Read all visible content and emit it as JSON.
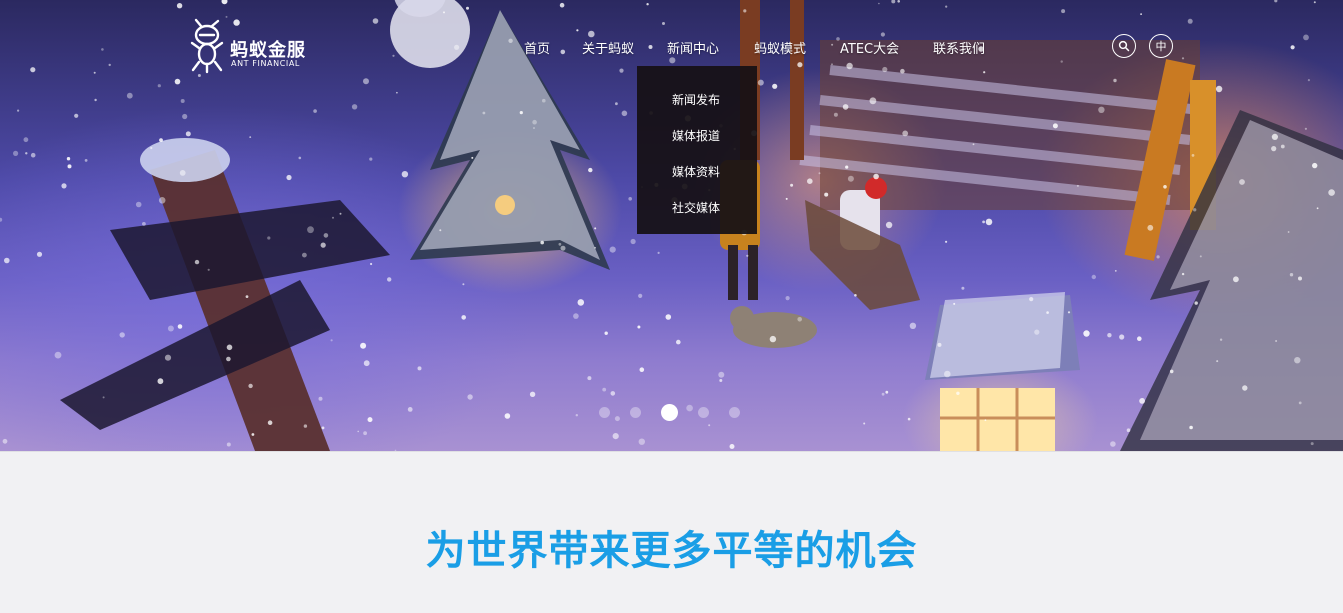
{
  "brand": {
    "name_cn": "蚂蚁金服",
    "name_en": "ANT FINANCIAL"
  },
  "nav": {
    "items": [
      {
        "label": "首页"
      },
      {
        "label": "关于蚂蚁"
      },
      {
        "label": "新闻中心"
      },
      {
        "label": "蚂蚁模式"
      },
      {
        "label": "ATEC大会"
      },
      {
        "label": "联系我们"
      }
    ],
    "active_index": 2,
    "language_label": "中",
    "search_icon": "search-icon"
  },
  "dropdown": {
    "parent": "新闻中心",
    "items": [
      {
        "label": "新闻发布"
      },
      {
        "label": "媒体报道"
      },
      {
        "label": "媒体资料"
      },
      {
        "label": "社交媒体"
      }
    ]
  },
  "carousel": {
    "slide_count": 5,
    "active_slide": 3
  },
  "content": {
    "slogan": "为世界带来更多平等的机会"
  },
  "colors": {
    "accent": "#1a9ee6",
    "dropdown_bg": "#161014",
    "page_bg": "#f1f1f3"
  }
}
